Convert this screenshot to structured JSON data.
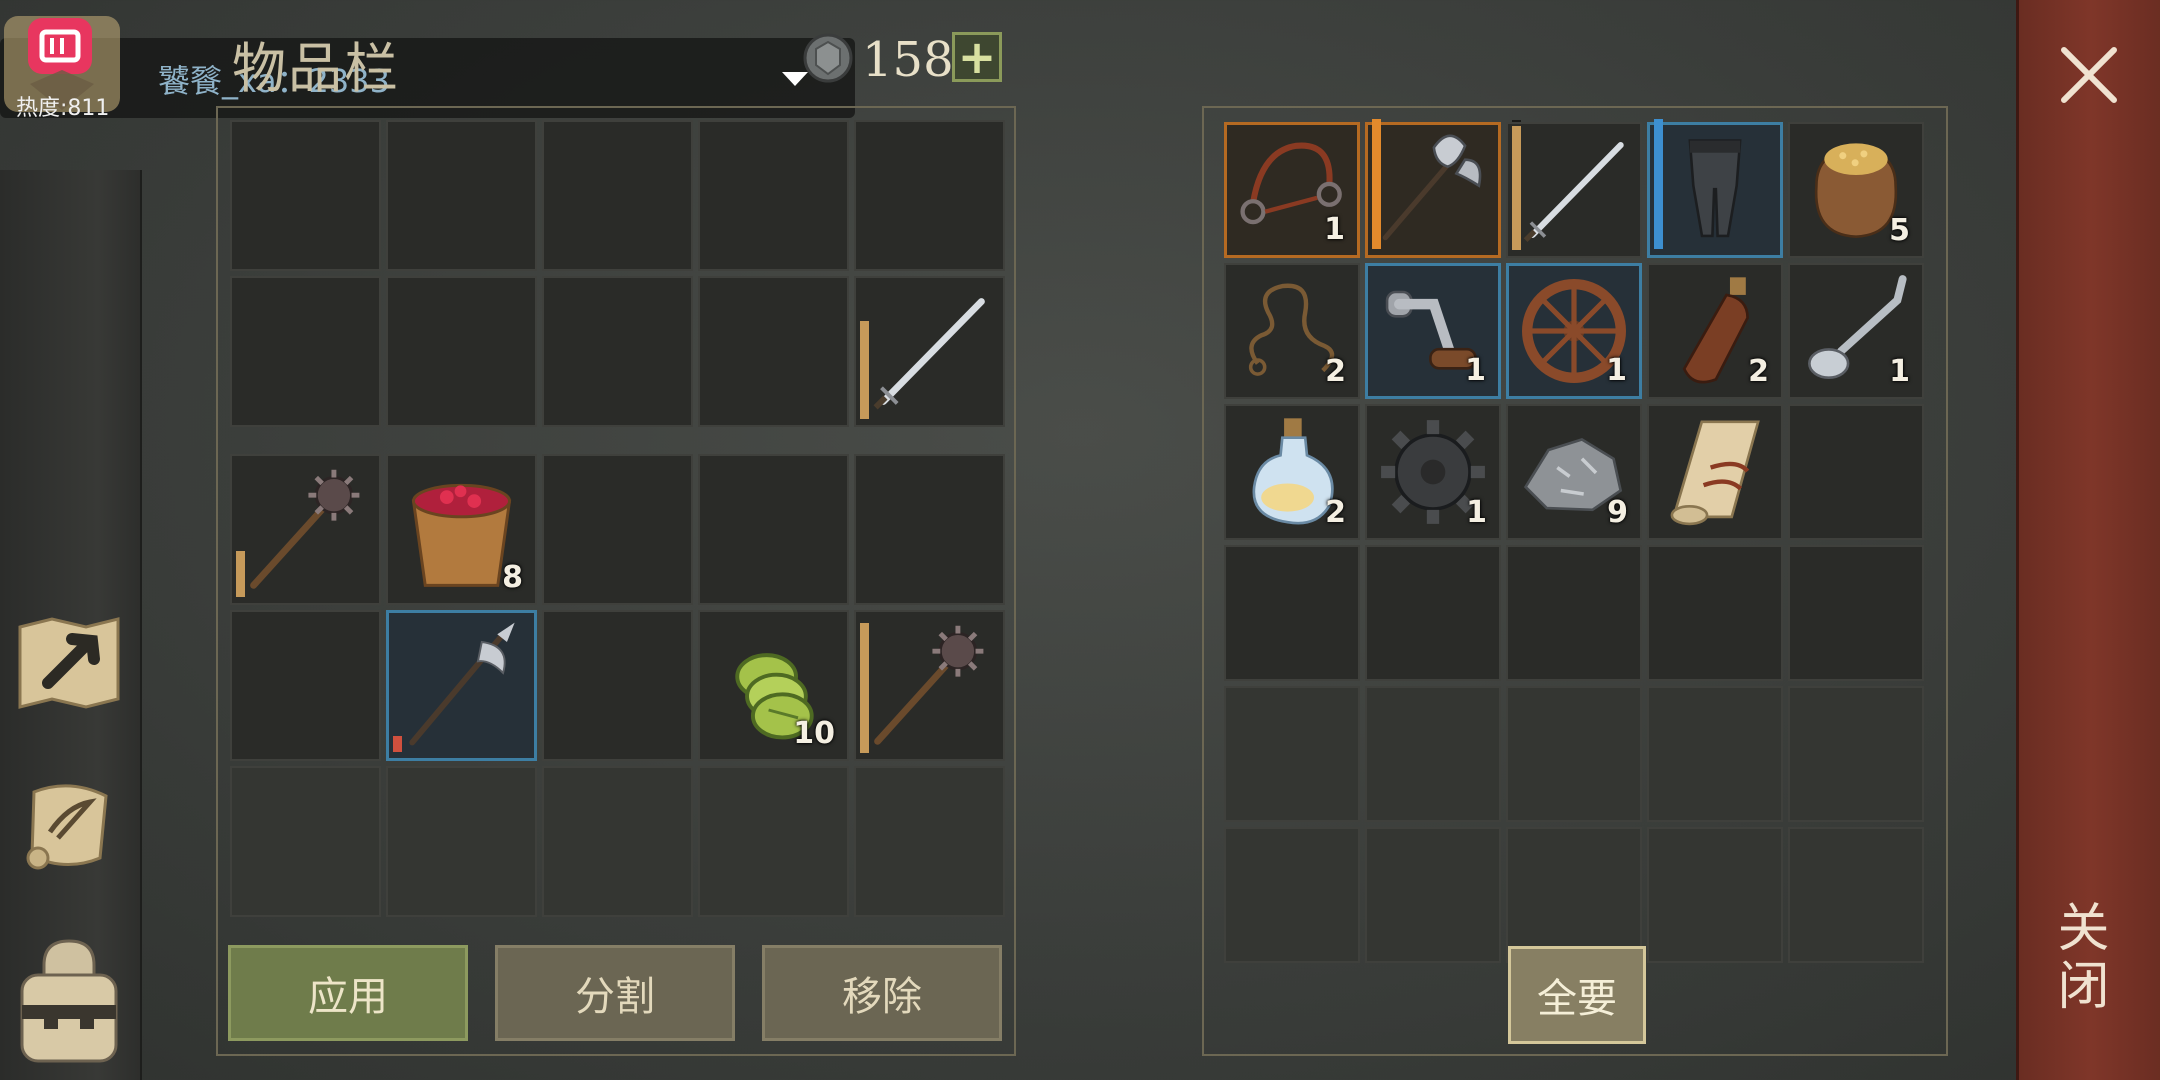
{
  "header": {
    "title": "物品栏",
    "currency_value": "158",
    "plus_label": "+"
  },
  "stream_overlay": {
    "user_text": "饕餮_xa：2333",
    "heat_text": "热度:811"
  },
  "left_inventory": {
    "items": [
      {
        "slot": 9,
        "name": "longsword-icon",
        "quality": 0.75,
        "quality_color": "#c69a5a",
        "count": ""
      },
      {
        "slot": 10,
        "name": "spiked-mace-icon",
        "quality": 0.35,
        "quality_color": "#c69a5a",
        "count": ""
      },
      {
        "slot": 11,
        "name": "berry-bucket-icon",
        "count": "8"
      },
      {
        "slot": 16,
        "name": "halberd-icon",
        "quality": 0.12,
        "quality_color": "#d0503e",
        "count": "",
        "rarity": "blue"
      },
      {
        "slot": 18,
        "name": "sliced-cucumber-icon",
        "count": "10"
      },
      {
        "slot": 19,
        "name": "spiked-mace-icon",
        "quality": 1.0,
        "quality_color": "#c69a5a",
        "count": ""
      }
    ]
  },
  "right_inventory": {
    "items": [
      {
        "slot": 0,
        "name": "bridle-icon",
        "count": "1",
        "rarity": "orange"
      },
      {
        "slot": 1,
        "name": "battle-axe-icon",
        "quality": 1.0,
        "quality_color": "#e38a2c",
        "count": "",
        "rarity": "orange"
      },
      {
        "slot": 2,
        "name": "longsword-icon",
        "quality": 0.95,
        "quality_color": "#c69a5a",
        "count": ""
      },
      {
        "slot": 3,
        "name": "chainmail-leggings-icon",
        "quality": 1.0,
        "quality_color": "#3d8fd0",
        "count": "",
        "rarity": "blue"
      },
      {
        "slot": 4,
        "name": "grain-sack-icon",
        "count": "5"
      },
      {
        "slot": 5,
        "name": "rope-icon",
        "count": "2"
      },
      {
        "slot": 6,
        "name": "hand-crank-icon",
        "count": "1",
        "rarity": "blue"
      },
      {
        "slot": 7,
        "name": "wooden-wheel-icon",
        "count": "1",
        "rarity": "blue"
      },
      {
        "slot": 8,
        "name": "leather-flask-icon",
        "count": "2"
      },
      {
        "slot": 9,
        "name": "spoon-icon",
        "count": "1"
      },
      {
        "slot": 10,
        "name": "potion-bottle-icon",
        "count": "2"
      },
      {
        "slot": 11,
        "name": "iron-gear-icon",
        "count": "1"
      },
      {
        "slot": 12,
        "name": "iron-ore-icon",
        "count": "9"
      },
      {
        "slot": 13,
        "name": "scroll-icon",
        "count": ""
      }
    ]
  },
  "buttons": {
    "apply": "应用",
    "split": "分割",
    "remove": "移除",
    "take_all": "全要",
    "close": "关闭"
  },
  "colors": {
    "apply_button": "#6f7c4b",
    "close_bar": "#7f3629",
    "rarity_orange": "#b56a22",
    "rarity_blue": "#3d7ea3"
  }
}
